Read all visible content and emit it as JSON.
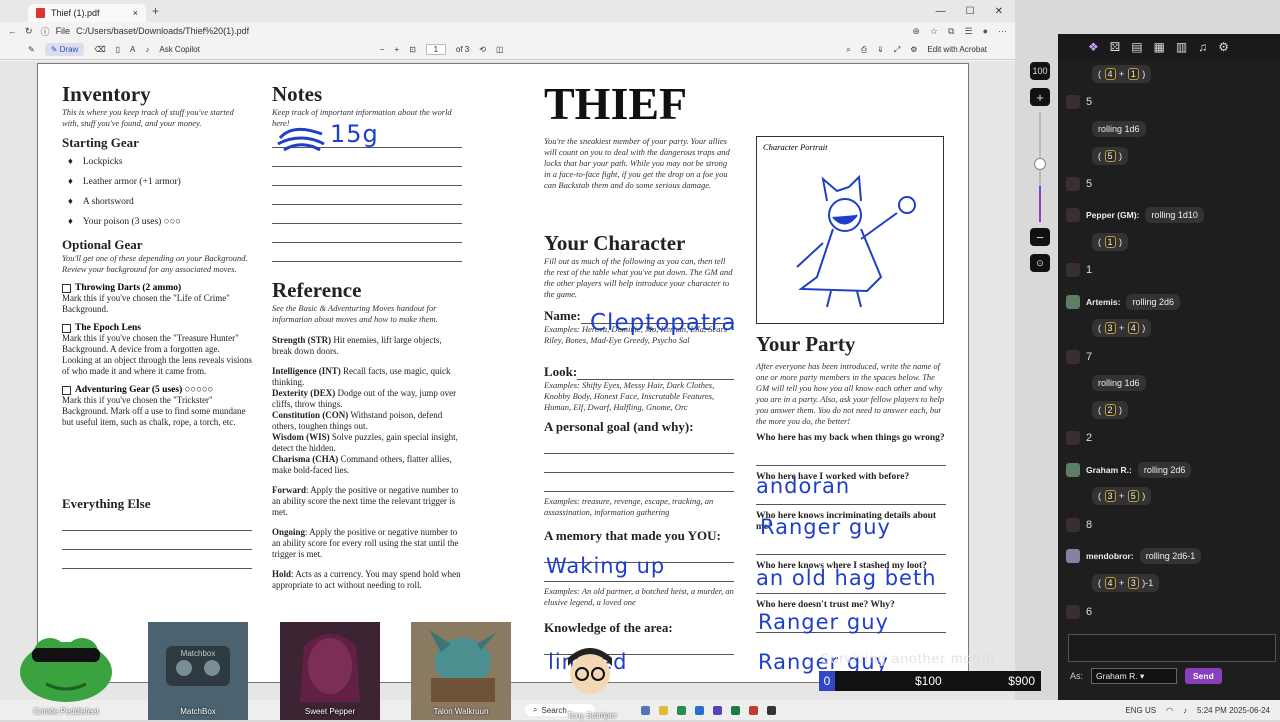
{
  "browser": {
    "tab_title": "Thief (1).pdf",
    "address_label": "File",
    "url": "C:/Users/baset/Downloads/Thief%20(1).pdf",
    "toolbar": {
      "draw": "Draw",
      "ask_copilot": "Ask Copilot",
      "page_current": "1",
      "page_total": "of 3",
      "edit": "Edit with Acrobat"
    }
  },
  "sheet": {
    "inventory": {
      "title": "Inventory",
      "subtitle": "This is where you keep track of stuff you've started with, stuff you've found, and your money.",
      "starting_gear_title": "Starting Gear",
      "starting_gear": [
        "Lockpicks",
        "Leather armor (+1 armor)",
        "A shortsword",
        "Your poison (3 uses) ○○○"
      ],
      "optional_title": "Optional Gear",
      "optional_subtitle": "You'll get one of these depending on your Background. Review your background for any associated moves.",
      "optional": [
        {
          "name": "Throwing Darts (2 ammo)",
          "desc": "Mark this if you've chosen the \"Life of Crime\" Background."
        },
        {
          "name": "The Epoch Lens",
          "desc": "Mark this if you've chosen the \"Treasure Hunter\" Background. A device from a forgotten age. Looking at an object through the lens reveals visions of who made it and where it came from."
        },
        {
          "name": "Adventuring Gear (5 uses) ○○○○○",
          "desc": "Mark this if you've chosen the \"Trickster\" Background. Mark off a use to find some mundane but useful item, such as chalk, rope, a torch, etc."
        }
      ],
      "everything_else": "Everything Else"
    },
    "notes": {
      "title": "Notes",
      "subtitle": "Keep track of important information about the world here!",
      "handwritten": "15g"
    },
    "reference": {
      "title": "Reference",
      "subtitle": "See the Basic & Adventuring Moves handout for information about moves and how to make them.",
      "items": [
        {
          "k": "Strength (STR)",
          "v": " Hit enemies, lift large objects, break down doors."
        },
        {
          "k": "Intelligence (INT)",
          "v": " Recall facts, use magic, quick thinking."
        },
        {
          "k": "Dexterity (DEX)",
          "v": "  Dodge out of the way, jump over cliffs, throw things."
        },
        {
          "k": "Constitution (CON)",
          "v": " Withstand poison, defend others, toughen things out."
        },
        {
          "k": "Wisdom (WIS)",
          "v": "  Solve puzzles, gain special insight, detect the hidden."
        },
        {
          "k": "Charisma (CHA)",
          "v": " Command others, flatter allies, make bold-faced lies."
        },
        {
          "k": "Forward",
          "v": ": Apply the positive or negative number to an ability score the next time the relevant trigger is met."
        },
        {
          "k": "Ongoing",
          "v": ": Apply the positive or negative number to an ability score for every roll using the stat until the trigger is met."
        },
        {
          "k": "Hold",
          "v": ": Acts as a currency. You may spend hold when appropriate to act without needing to roll."
        }
      ]
    },
    "thief": {
      "title": "THIEF",
      "desc": "You're the sneakiest member of your party. Your allies will count on you to deal with the dangerous traps and locks that bar your path. While you may not be strong in a face-to-face fight, if you get the drop on a foe you can Backstab them and do some serious damage.",
      "portrait_label": "Character Portrait"
    },
    "character": {
      "title": "Your Character",
      "subtitle": "Fill out as much of the following as you can, then tell the rest of the table what you've put down. The GM and the other players will help introduce your character to the game.",
      "name_label": "Name:",
      "name_value": "Cleptopatra",
      "name_examples": "Examples: Herova, Dominic, Mo, Kernan, Lila, Scars Riley, Bones, Mad-Eye Greedy, Psycho Sal",
      "look_label": "Look:",
      "look_examples": "Examples: Shifty Eyes, Messy Hair, Dark Clothes, Knobby Body, Honest Face, Inscrutable Features, Human, Elf, Dwarf, Halfling, Gnome, Orc",
      "goal_label": "A personal goal (and why):",
      "goal_examples": "Examples: treasure, revenge, escape, tracking, an assassination, information gathering",
      "memory_label": "A memory that made you YOU:",
      "memory_value": "Waking up",
      "memory_examples": "Examples: An old partner, a botched heist, a murder, an elusive legend, a loved one",
      "knowledge_label": "Knowledge of the area:",
      "knowledge_value": "limited"
    },
    "party": {
      "title": "Your Party",
      "subtitle": "After everyone has been introduced, write the name of one or more party members in the spaces below. The GM will tell you how you all know each other and why you are in a party. Also, ask your fellow players to help you answer them. You do not need to answer each, but the more you do, the better!",
      "questions": [
        {
          "q": "Who here has my back when things go wrong?",
          "a": "andoran"
        },
        {
          "q": "Who here have I worked with before?",
          "a": "Ranger guy"
        },
        {
          "q": "Who here knows incriminating details about me?",
          "a": "an old hag beth"
        },
        {
          "q": "Who here knows where I stashed my loot?",
          "a": "Ranger guy"
        },
        {
          "q": "Who here doesn't trust me? Why?",
          "a": "Ranger guy"
        }
      ]
    }
  },
  "zoom": {
    "value": "100"
  },
  "chat": {
    "messages": [
      {
        "type": "roll",
        "dice": [
          "4",
          "1"
        ]
      },
      {
        "type": "result",
        "value": "5"
      },
      {
        "type": "text",
        "text": "rolling 1d6"
      },
      {
        "type": "roll",
        "dice": [
          "5"
        ]
      },
      {
        "type": "result",
        "value": "5"
      },
      {
        "type": "named",
        "name": "Pepper (GM):",
        "text": "rolling 1d10"
      },
      {
        "type": "roll",
        "dice": [
          "1"
        ]
      },
      {
        "type": "result",
        "value": "1"
      },
      {
        "type": "named",
        "name": "Artemis:",
        "text": "rolling 2d6"
      },
      {
        "type": "roll",
        "dice": [
          "3",
          "4"
        ]
      },
      {
        "type": "result",
        "value": "7"
      },
      {
        "type": "text",
        "text": "rolling 1d6"
      },
      {
        "type": "roll",
        "dice": [
          "2"
        ]
      },
      {
        "type": "result",
        "value": "2"
      },
      {
        "type": "named",
        "name": "Graham R.:",
        "text": "rolling 2d6"
      },
      {
        "type": "roll",
        "dice": [
          "3",
          "5"
        ]
      },
      {
        "type": "result",
        "value": "8"
      },
      {
        "type": "named",
        "name": "mendobror:",
        "text": "rolling 2d6-1"
      },
      {
        "type": "roll",
        "dice": [
          "4",
          "3"
        ],
        "suffix": "-1"
      },
      {
        "type": "result",
        "value": "6"
      }
    ],
    "as_label": "As:",
    "as_value": "Graham R.",
    "send": "Send"
  },
  "goal": {
    "title": "Surviving another month",
    "current": "0",
    "mark1": "$100",
    "mark2": "$900"
  },
  "cams": [
    {
      "name": "Crinkle Peddlefeet"
    },
    {
      "name": "MatchBox"
    },
    {
      "name": "Sweet Pepper"
    },
    {
      "name": "Talon Walkruun"
    },
    {
      "name": "Tony Stomper"
    }
  ],
  "taskbar": {
    "search": "Search",
    "lang": "ENG\nUS",
    "time": "5:24 PM",
    "date": "2025-06-24"
  },
  "colors": {
    "accent": "#8a3fbf",
    "ink": "#1f3fc8",
    "goal": "#2f46c6"
  }
}
